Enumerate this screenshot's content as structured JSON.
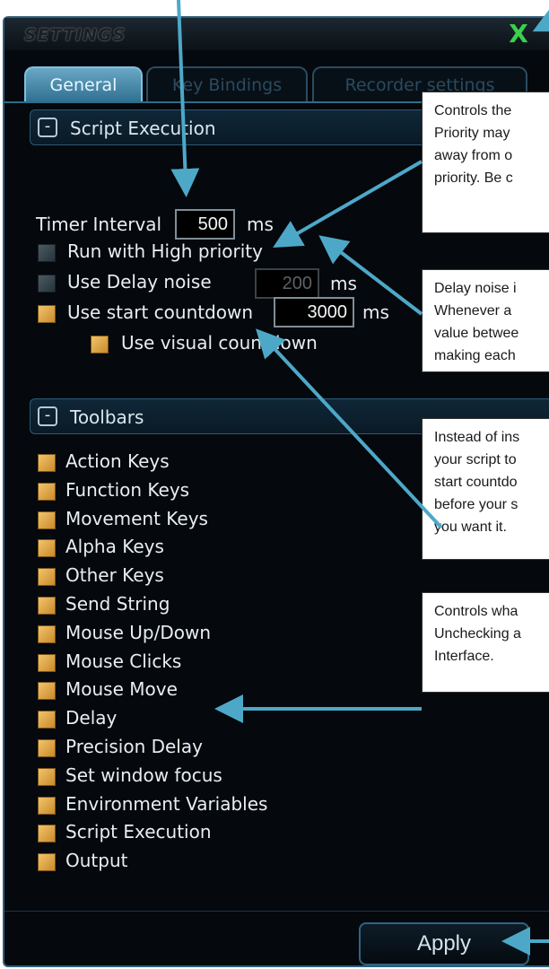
{
  "window": {
    "title": "SETTINGS",
    "close_label": "X"
  },
  "tabs": [
    {
      "label": "General",
      "active": true
    },
    {
      "label": "Key Bindings",
      "active": false
    },
    {
      "label": "Recorder settings",
      "active": false
    }
  ],
  "script_execution": {
    "header": "Script Execution",
    "toggle": "-",
    "timer_interval_label": "Timer Interval",
    "timer_interval_value": "500",
    "timer_unit": "ms",
    "high_priority": {
      "label": "Run with High priority",
      "checked": false
    },
    "delay_noise": {
      "label": "Use Delay noise",
      "checked": false,
      "value": "200",
      "unit": "ms"
    },
    "start_countdown": {
      "label": "Use start countdown",
      "checked": true,
      "value": "3000",
      "unit": "ms"
    },
    "visual_countdown": {
      "label": "Use visual countdown",
      "checked": true
    }
  },
  "toolbars": {
    "header": "Toolbars",
    "toggle": "-",
    "items": [
      {
        "label": "Action Keys",
        "checked": true
      },
      {
        "label": "Function Keys",
        "checked": true
      },
      {
        "label": "Movement Keys",
        "checked": true
      },
      {
        "label": "Alpha Keys",
        "checked": true
      },
      {
        "label": "Other Keys",
        "checked": true
      },
      {
        "label": "Send String",
        "checked": true
      },
      {
        "label": "Mouse Up/Down",
        "checked": true
      },
      {
        "label": "Mouse Clicks",
        "checked": true
      },
      {
        "label": "Mouse Move",
        "checked": true
      },
      {
        "label": "Delay",
        "checked": true
      },
      {
        "label": "Precision Delay",
        "checked": true
      },
      {
        "label": "Set window focus",
        "checked": true
      },
      {
        "label": "Environment Variables",
        "checked": true
      },
      {
        "label": "Script Execution",
        "checked": true
      },
      {
        "label": "Output",
        "checked": true
      }
    ]
  },
  "apply_label": "Apply",
  "callouts": [
    {
      "lines": [
        "Controls the",
        "Priority may",
        "away from o",
        "priority. Be c"
      ]
    },
    {
      "lines": [
        "Delay noise i",
        "Whenever a",
        "value betwee",
        "making each"
      ]
    },
    {
      "lines": [
        "Instead of ins",
        "your script to",
        "start countdo",
        "before your s",
        "you want it."
      ]
    },
    {
      "lines": [
        "Controls wha",
        "Unchecking a",
        "Interface."
      ]
    }
  ],
  "colors": {
    "window_bg": "#05080c",
    "accent": "#4da8c8",
    "checkbox_on": "#e0a84a",
    "close_green": "#39d24a"
  }
}
